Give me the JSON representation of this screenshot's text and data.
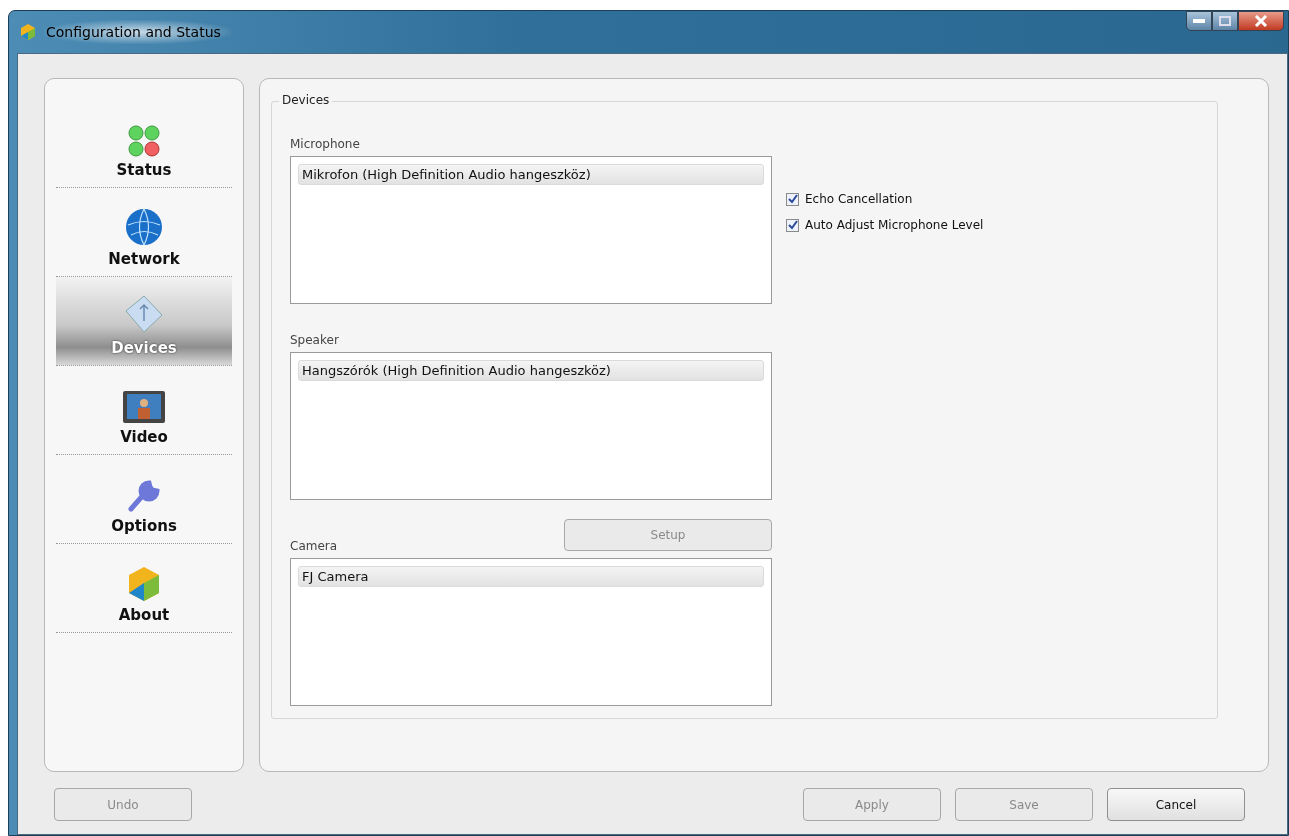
{
  "window": {
    "title": "Configuration and Status"
  },
  "sidebar": {
    "items": [
      {
        "label": "Status",
        "selected": false
      },
      {
        "label": "Network",
        "selected": false
      },
      {
        "label": "Devices",
        "selected": true
      },
      {
        "label": "Video",
        "selected": false
      },
      {
        "label": "Options",
        "selected": false
      },
      {
        "label": "About",
        "selected": false
      }
    ]
  },
  "devices": {
    "title": "Devices",
    "microphone": {
      "label": "Microphone",
      "items": [
        {
          "name": "Mikrofon (High Definition Audio hangeszköz)",
          "selected": true
        }
      ]
    },
    "options": [
      {
        "label": "Echo Cancellation",
        "checked": true
      },
      {
        "label": "Auto Adjust Microphone Level",
        "checked": true
      }
    ],
    "speaker": {
      "label": "Speaker",
      "items": [
        {
          "name": "Hangszórók (High Definition Audio hangeszköz)",
          "selected": true
        }
      ]
    },
    "camera": {
      "label": "Camera",
      "setup": {
        "label": "Setup",
        "disabled": true
      },
      "items": [
        {
          "name": "FJ Camera",
          "selected": true
        }
      ]
    }
  },
  "buttons": [
    {
      "label": "Undo",
      "disabled": true
    },
    {
      "label": "Apply",
      "disabled": true
    },
    {
      "label": "Save",
      "disabled": true
    },
    {
      "label": "Cancel",
      "disabled": false
    }
  ]
}
